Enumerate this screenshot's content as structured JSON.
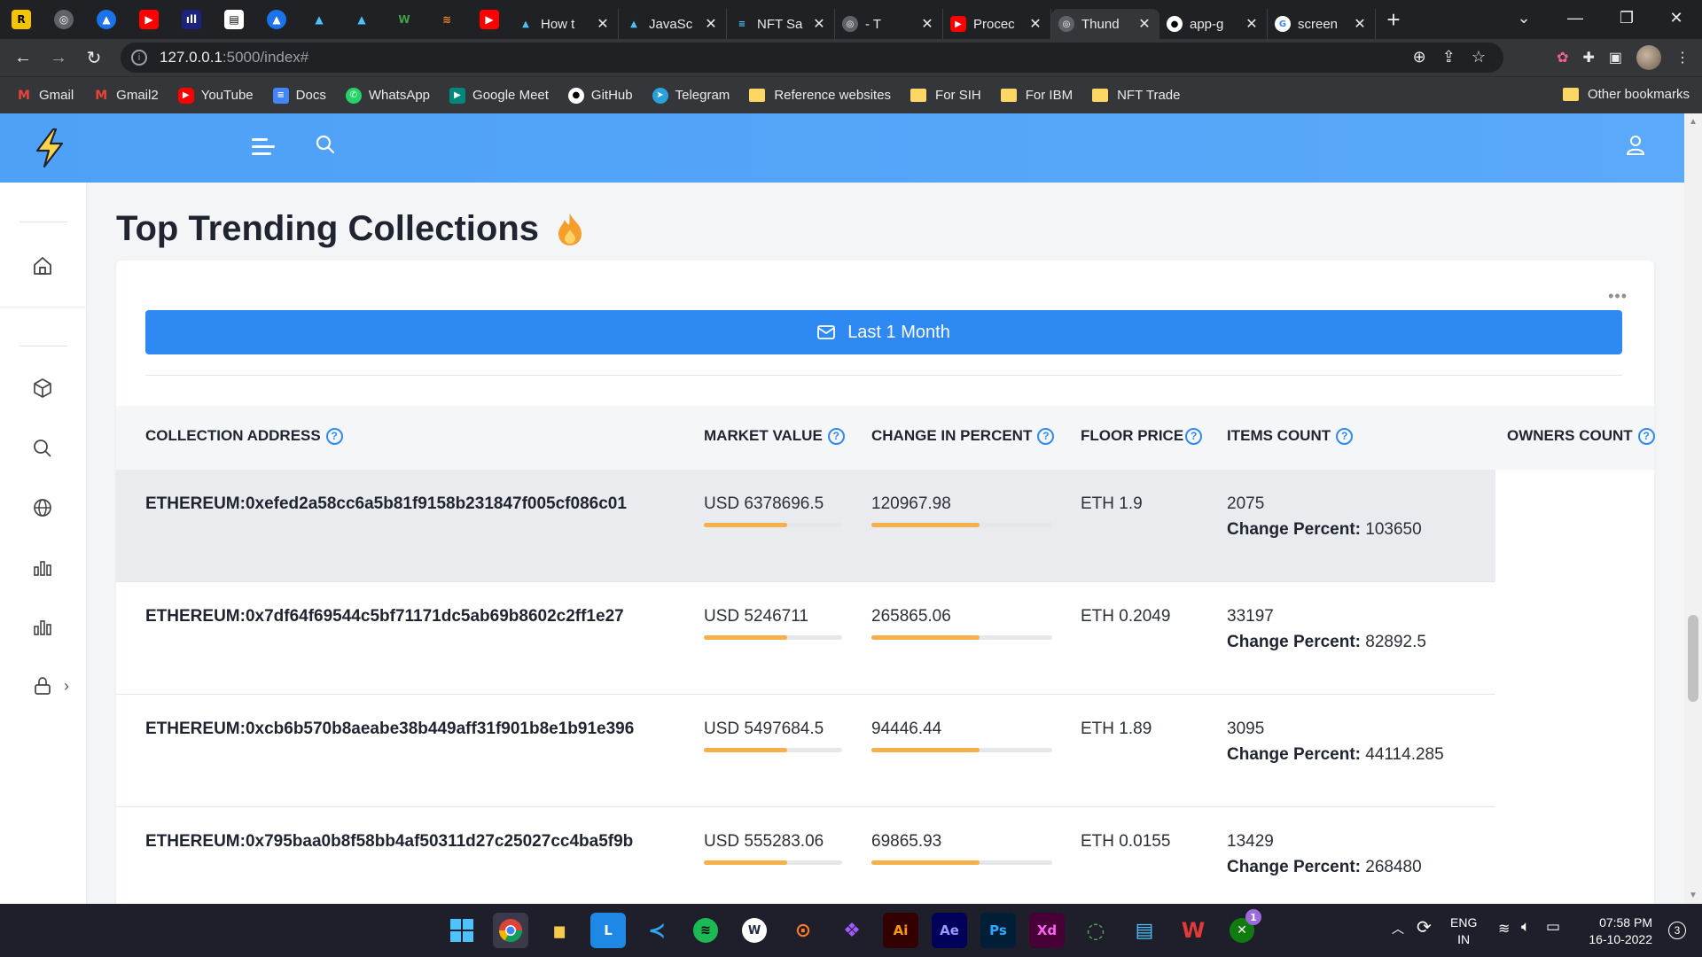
{
  "browser": {
    "tabs": [
      {
        "label": "How t",
        "icon": "sketch-icon"
      },
      {
        "label": "JavaSc",
        "icon": "sketch-icon"
      },
      {
        "label": "NFT Sa",
        "icon": "nft-icon"
      },
      {
        "label": "- T",
        "icon": "globe-icon"
      },
      {
        "label": "Procec",
        "icon": "youtube-icon"
      },
      {
        "label": "Thund",
        "icon": "globe-icon"
      },
      {
        "label": "app-g",
        "icon": "github-icon"
      },
      {
        "label": "screen",
        "icon": "google-icon"
      }
    ],
    "address": {
      "host": "127.0.0.1",
      "path": ":5000/index#"
    },
    "bookmarks": [
      "Gmail",
      "Gmail2",
      "YouTube",
      "Docs",
      "WhatsApp",
      "Google Meet",
      "GitHub",
      "Telegram"
    ],
    "bookmark_folders": [
      "Reference websites",
      "For SIH",
      "For IBM",
      "NFT Trade"
    ],
    "other_bookmarks": "Other bookmarks"
  },
  "page": {
    "title": "Top Trending Collections",
    "filter_label": "Last 1 Month",
    "more": "•••"
  },
  "table": {
    "headers": {
      "address": "COLLECTION ADDRESS",
      "market_value": "MARKET VALUE",
      "change": "CHANGE IN PERCENT",
      "floor": "FLOOR PRICE",
      "items": "ITEMS COUNT",
      "owners": "OWNERS COUNT"
    },
    "help_glyph": "?",
    "change_label": "Change Percent:",
    "rows": [
      {
        "address": "ETHEREUM:0xefed2a58cc6a5b81f9158b231847f005cf086c01",
        "market_value": "USD 6378696.5",
        "change": "120967.98",
        "floor": "ETH 1.9",
        "items": "2075",
        "items_change": "103650",
        "mv_progress": 0.6,
        "ch_progress": 0.6
      },
      {
        "address": "ETHEREUM:0x7df64f69544c5bf71171dc5ab69b8602c2ff1e27",
        "market_value": "USD 5246711",
        "change": "265865.06",
        "floor": "ETH 0.2049",
        "items": "33197",
        "items_change": "82892.5",
        "mv_progress": 0.6,
        "ch_progress": 0.6
      },
      {
        "address": "ETHEREUM:0xcb6b570b8aeabe38b449aff31f901b8e1b91e396",
        "market_value": "USD 5497684.5",
        "change": "94446.44",
        "floor": "ETH 1.89",
        "items": "3095",
        "items_change": "44114.285",
        "mv_progress": 0.6,
        "ch_progress": 0.6
      },
      {
        "address": "ETHEREUM:0x795baa0b8f58bb4af50311d27c25027cc4ba5f9b",
        "market_value": "USD 555283.06",
        "change": "69865.93",
        "floor": "ETH 0.0155",
        "items": "13429",
        "items_change": "268480",
        "mv_progress": 0.6,
        "ch_progress": 0.6
      }
    ]
  },
  "taskbar": {
    "lang_top": "ENG",
    "lang_bottom": "IN",
    "time": "07:58 PM",
    "date": "16-10-2022",
    "notification_count": "3",
    "badge": "1"
  },
  "colors": {
    "header": "#4ea1f7",
    "primary": "#2e8af2",
    "progress": "#f5b04a"
  }
}
